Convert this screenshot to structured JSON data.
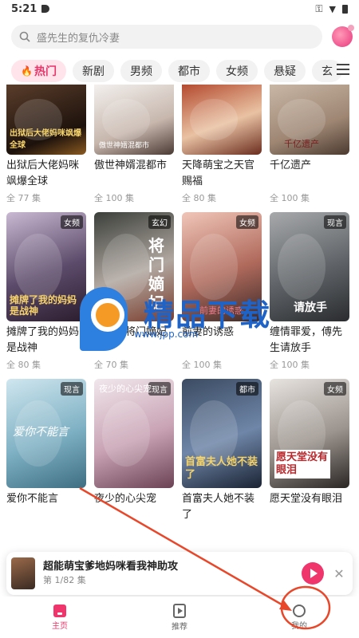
{
  "status_bar": {
    "time": "5:21"
  },
  "search": {
    "placeholder": "盛先生的复仇冷妻"
  },
  "tabs": [
    {
      "label": "热门",
      "icon": "fire-icon",
      "active": true
    },
    {
      "label": "新剧"
    },
    {
      "label": "男频"
    },
    {
      "label": "都市"
    },
    {
      "label": "女频"
    },
    {
      "label": "悬疑"
    },
    {
      "label": "玄"
    }
  ],
  "dramas": [
    {
      "title": "出狱后大佬妈咪飒爆全球",
      "count": "全 77 集",
      "badge": "",
      "poster_text": "出狱后大佬妈咪飒爆全球"
    },
    {
      "title": "傲世神婿混都市",
      "count": "全 100 集",
      "badge": "",
      "poster_text": "傲世神婿混都市"
    },
    {
      "title": "天降萌宝之天官赐福",
      "count": "全 80 集",
      "badge": "",
      "poster_text": ""
    },
    {
      "title": "千亿遗产",
      "count": "全 100 集",
      "badge": "",
      "poster_text": "千亿遗产"
    },
    {
      "title": "摊牌了我的妈妈是战神",
      "count": "全 80 集",
      "badge": "女频",
      "poster_text": "摊牌了我的妈妈是战神"
    },
    {
      "title": "重生之将门嫡妃",
      "count": "全 70 集",
      "badge": "玄幻",
      "poster_text": "将门嫡妃"
    },
    {
      "title": "前妻的诱惑",
      "count": "全 100 集",
      "badge": "女频",
      "poster_text": "前妻的诱惑"
    },
    {
      "title": "缠情罪爱，傅先生请放手",
      "count": "全 100 集",
      "badge": "现言",
      "poster_text": "请放手"
    },
    {
      "title": "爱你不能言",
      "count": "",
      "badge": "现言",
      "poster_text": "爱你不能言"
    },
    {
      "title": "夜少的心尖宠",
      "count": "",
      "badge": "现言",
      "poster_text": "夜少的心尖宠"
    },
    {
      "title": "首富夫人她不装了",
      "count": "",
      "badge": "都市",
      "poster_text": "首富夫人她不装了"
    },
    {
      "title": "愿天堂没有眼泪",
      "count": "",
      "badge": "女频",
      "poster_text": "愿天堂没有眼泪"
    }
  ],
  "mini_player": {
    "title": "超能萌宝爹地妈咪看我神助攻",
    "episode": "第 1/82 集"
  },
  "bottom_nav": [
    {
      "label": "主页",
      "icon": "home-icon",
      "active": true
    },
    {
      "label": "推荐",
      "icon": "play-square-icon"
    },
    {
      "label": "我的",
      "icon": "profile-icon"
    }
  ],
  "watermark": {
    "text": "精品下载",
    "url": "www.jpp.com"
  },
  "colors": {
    "accent": "#f0346c",
    "annotation": "#e8472a"
  }
}
